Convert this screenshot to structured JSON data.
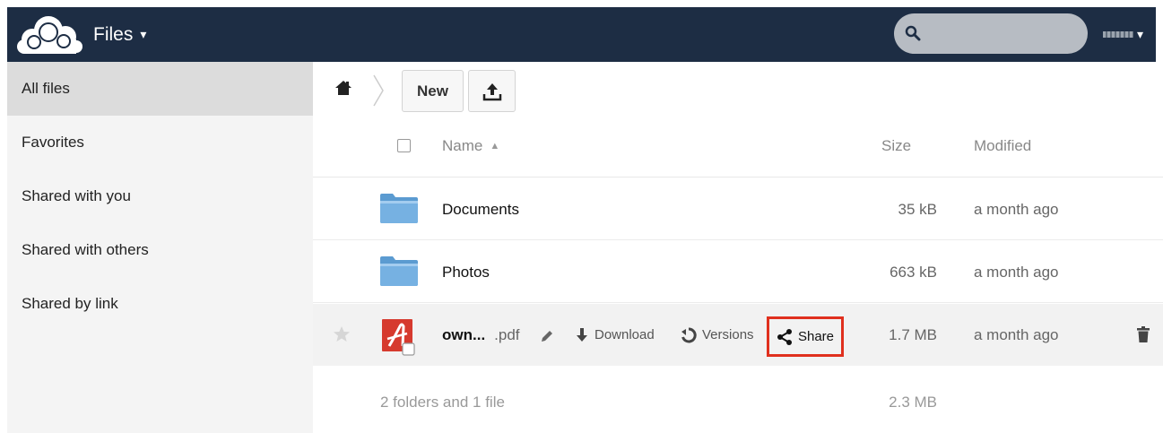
{
  "header": {
    "app_name": "Files",
    "app_caret": "▾",
    "user_caret": "▾",
    "accent_color": "#1d2d44"
  },
  "sidebar": {
    "items": [
      {
        "label": "All files"
      },
      {
        "label": "Favorites"
      },
      {
        "label": "Shared with you"
      },
      {
        "label": "Shared with others"
      },
      {
        "label": "Shared by link"
      }
    ]
  },
  "controls": {
    "new_label": "New"
  },
  "table": {
    "headers": {
      "name": "Name",
      "sort_indicator": "▲",
      "size": "Size",
      "modified": "Modified"
    },
    "rows": [
      {
        "name": "Documents",
        "size": "35 kB",
        "modified": "a month ago",
        "icon": "folder-icon"
      },
      {
        "name": "Photos",
        "size": "663 kB",
        "modified": "a month ago",
        "icon": "folder-icon"
      },
      {
        "name": "own...",
        "ext": ".pdf",
        "size": "1.7 MB",
        "modified": "a month ago",
        "icon": "pdf-icon"
      }
    ],
    "actions": {
      "download": "Download",
      "versions": "Versions",
      "share": "Share"
    },
    "summary": {
      "text": "2 folders and 1 file",
      "total": "2.3 MB"
    }
  },
  "highlight_color": "#e0301e"
}
